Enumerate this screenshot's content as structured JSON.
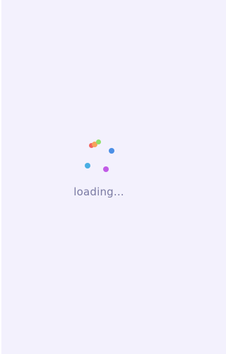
{
  "loader": {
    "text": "loading...",
    "dots": [
      {
        "name": "dot-red",
        "color": "#f2635f"
      },
      {
        "name": "dot-orange",
        "color": "#f5a25a"
      },
      {
        "name": "dot-green",
        "color": "#8fe06a"
      },
      {
        "name": "dot-blue",
        "color": "#4b8fe6"
      },
      {
        "name": "dot-cyan",
        "color": "#49aee3"
      },
      {
        "name": "dot-purple",
        "color": "#c15be6"
      }
    ],
    "colors": {
      "background": "#f3f1fd",
      "text": "#7a7aa3"
    }
  }
}
